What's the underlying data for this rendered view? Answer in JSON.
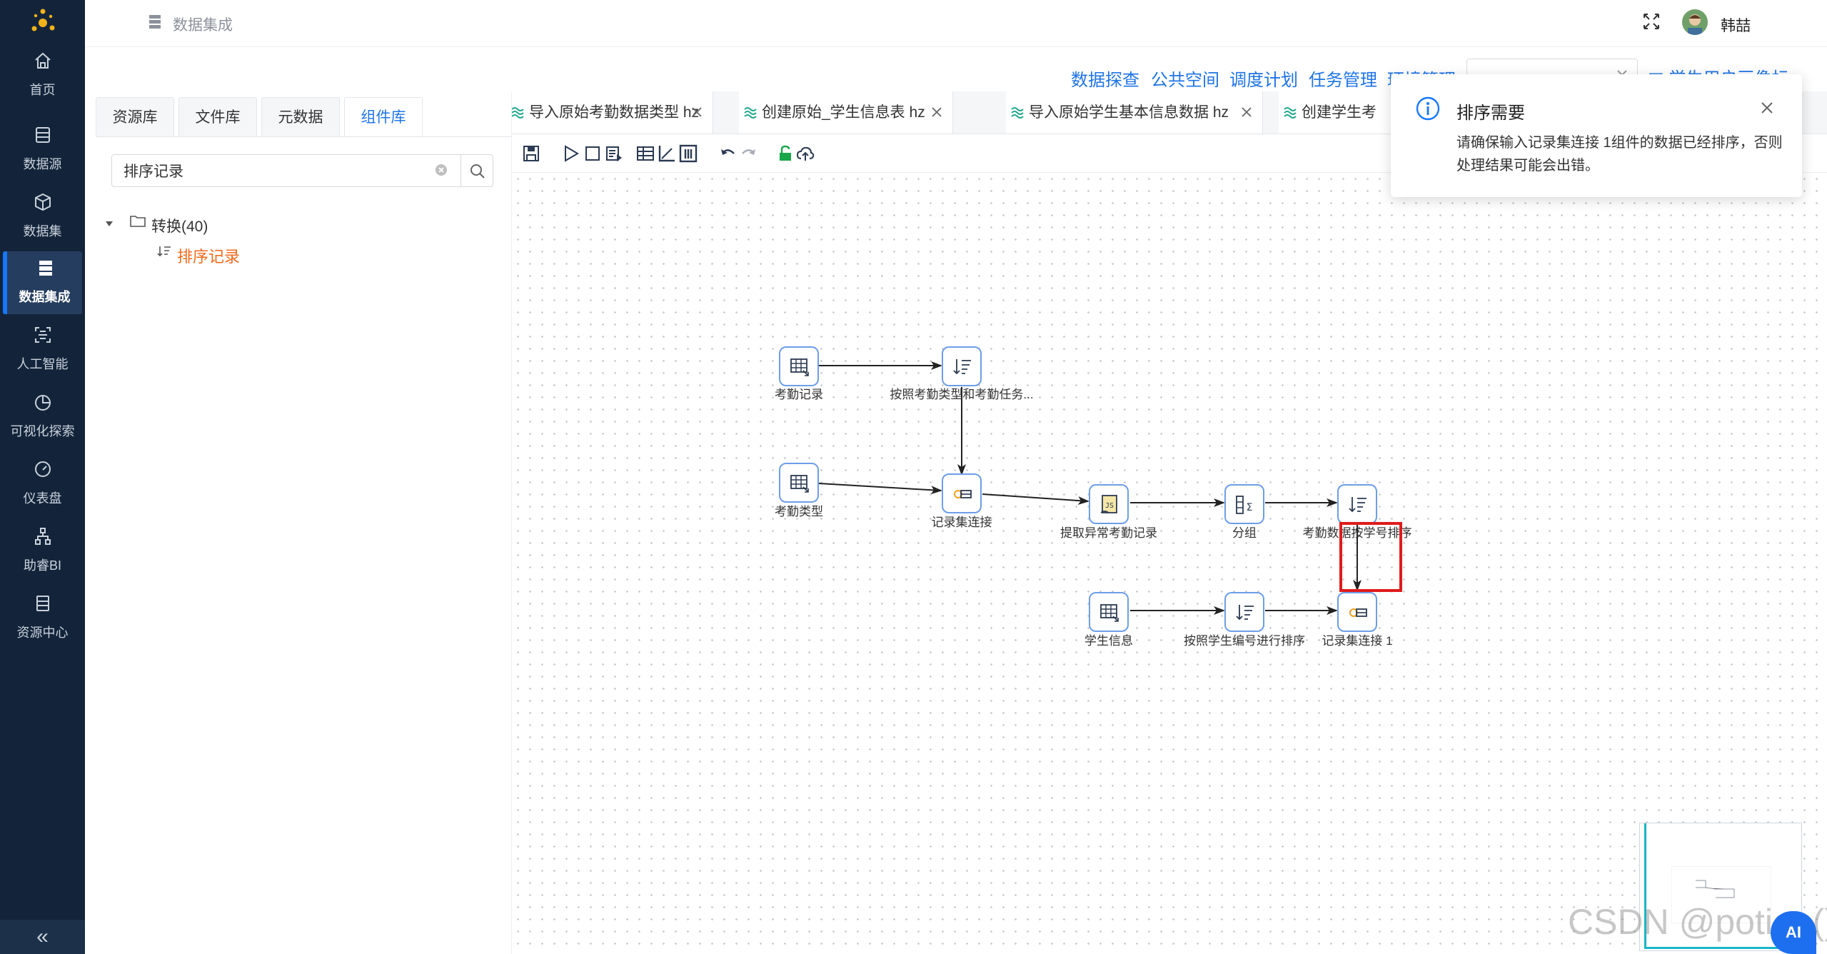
{
  "nav": {
    "items": [
      {
        "label": "首页",
        "icon": "home-icon"
      },
      {
        "label": "数据源",
        "icon": "database-icon"
      },
      {
        "label": "数据集",
        "icon": "cube-icon"
      },
      {
        "label": "数据集成",
        "icon": "server-icon"
      },
      {
        "label": "人工智能",
        "icon": "ai-icon"
      },
      {
        "label": "可视化探索",
        "icon": "pie-chart-icon"
      },
      {
        "label": "仪表盘",
        "icon": "gauge-icon"
      },
      {
        "label": "助睿BI",
        "icon": "org-chart-icon"
      },
      {
        "label": "资源中心",
        "icon": "resource-icon"
      }
    ],
    "active": "数据集成",
    "collapse_label": "«"
  },
  "header": {
    "breadcrumb": "数据集成",
    "user_name": "韩喆"
  },
  "top_links": [
    "数据探查",
    "公共空间",
    "调度计划",
    "任务管理",
    "环境管理"
  ],
  "top_right_partial": "学生用户画像标",
  "left_panel": {
    "tabs": [
      "资源库",
      "文件库",
      "元数据",
      "组件库"
    ],
    "active_tab": "组件库",
    "search_value": "排序记录",
    "tree_root": "转换(40)",
    "tree_leaf": "排序记录"
  },
  "editor_tabs": [
    {
      "title": "导入原始考勤数据类型 hz"
    },
    {
      "title": "创建原始_学生信息表 hz"
    },
    {
      "title": "导入原始学生基本信息数据 hz"
    },
    {
      "title": "创建学生考"
    }
  ],
  "flow": {
    "nodes": [
      {
        "id": "n1",
        "label": "考勤记录",
        "icon": "table-input-icon"
      },
      {
        "id": "n2",
        "label": "按照考勤类型和考勤任务...",
        "icon": "sort-icon"
      },
      {
        "id": "n3",
        "label": "考勤类型",
        "icon": "table-input-icon"
      },
      {
        "id": "n4",
        "label": "记录集连接",
        "icon": "merge-join-icon"
      },
      {
        "id": "n5",
        "label": "提取异常考勤记录",
        "icon": "script-icon"
      },
      {
        "id": "n6",
        "label": "分组",
        "icon": "group-by-icon"
      },
      {
        "id": "n7",
        "label": "考勤数据按学号排序",
        "icon": "sort-icon"
      },
      {
        "id": "n8",
        "label": "学生信息",
        "icon": "table-input-icon"
      },
      {
        "id": "n9",
        "label": "按照学生编号进行排序",
        "icon": "sort-icon"
      },
      {
        "id": "n10",
        "label": "记录集连接 1",
        "icon": "merge-join-icon"
      }
    ]
  },
  "notice": {
    "title": "排序需要",
    "body": "请确保输入记录集连接 1组件的数据已经排序，否则处理结果可能会出错。"
  },
  "watermark": "CSDN @potion()",
  "ai_button": "AI",
  "colors": {
    "nav_bg": "#13243a",
    "accent": "#1f74e8",
    "tree_leaf": "#f06a1d",
    "highlight": "#e01b1b"
  }
}
